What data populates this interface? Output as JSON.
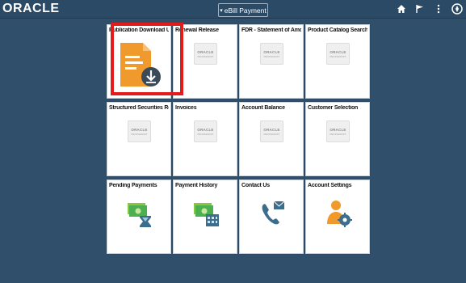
{
  "header": {
    "logo_text": "ORACLE",
    "home_label": "eBill Payment",
    "icons": [
      "home-icon",
      "flag-icon",
      "more-icon",
      "navbar-icon"
    ]
  },
  "colors": {
    "background": "#2f4f6b",
    "header": "#2b4a66",
    "highlight": "#e31b1b",
    "doc_orange": "#f0992c"
  },
  "placeholder": {
    "brand": "ORACLE",
    "sub": "PEOPLESOFT"
  },
  "tiles": [
    {
      "title": "Publication Download Updates",
      "icon": "document-download-icon"
    },
    {
      "title": "Renewal Release",
      "icon": "oracle-peoplesoft-placeholder"
    },
    {
      "title": "FDR - Statement of Amount Due",
      "icon": "oracle-peoplesoft-placeholder"
    },
    {
      "title": "Product Catalog Search",
      "icon": "oracle-peoplesoft-placeholder"
    },
    {
      "title": "Structured Securities Review",
      "icon": "oracle-peoplesoft-placeholder"
    },
    {
      "title": "Invoices",
      "icon": "oracle-peoplesoft-placeholder"
    },
    {
      "title": "Account Balance",
      "icon": "oracle-peoplesoft-placeholder"
    },
    {
      "title": "Customer Selection",
      "icon": "oracle-peoplesoft-placeholder"
    },
    {
      "title": "Pending Payments",
      "icon": "money-hourglass-icon"
    },
    {
      "title": "Payment History",
      "icon": "money-calendar-icon"
    },
    {
      "title": "Contact Us",
      "icon": "phone-mail-icon"
    },
    {
      "title": "Account Settings",
      "icon": "user-gear-icon"
    }
  ]
}
